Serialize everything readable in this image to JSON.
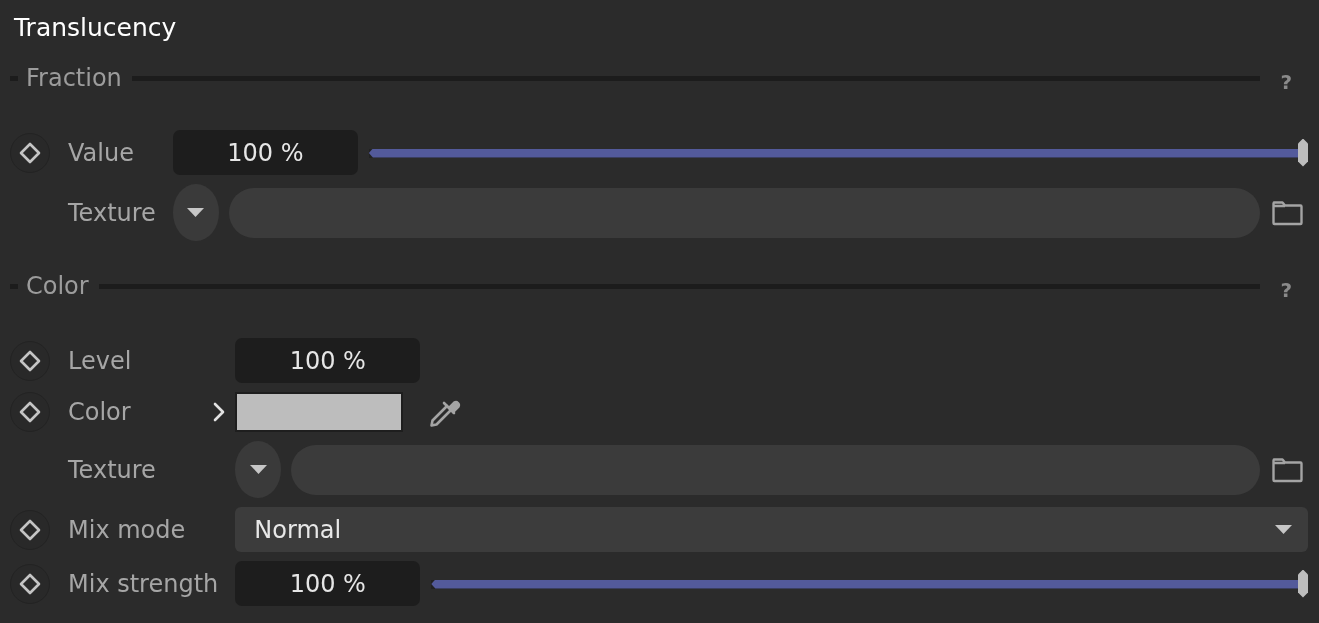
{
  "title": "Translucency",
  "sections": [
    {
      "heading": "Fraction",
      "help": "?",
      "rows": [
        {
          "kind": "number_slider",
          "label": "Value",
          "keyframe": true,
          "value": "100 %",
          "level": 1
        },
        {
          "kind": "texture",
          "label": "Texture",
          "keyframe": false
        }
      ]
    },
    {
      "heading": "Color",
      "help": "?",
      "rows": [
        {
          "kind": "number",
          "label": "Level",
          "keyframe": true,
          "value": "100 %"
        },
        {
          "kind": "color",
          "label": "Color",
          "keyframe": true,
          "expanded": false,
          "color": "#bdbdbd"
        },
        {
          "kind": "texture",
          "label": "Texture",
          "keyframe": false
        },
        {
          "kind": "dropdown",
          "label": "Mix mode",
          "keyframe": true,
          "value": "Normal"
        },
        {
          "kind": "number_slider",
          "label": "Mix strength",
          "keyframe": true,
          "value": "100 %",
          "level": 1
        }
      ]
    }
  ]
}
